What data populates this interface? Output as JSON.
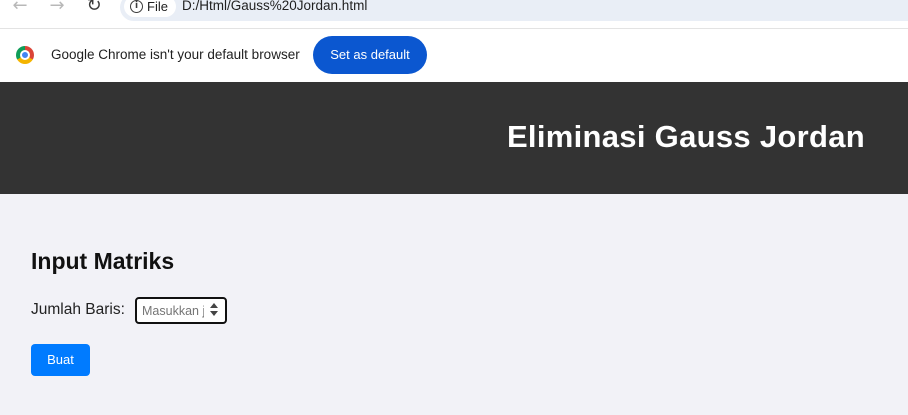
{
  "browser": {
    "site_chip_label": "File",
    "url": "D:/Html/Gauss%20Jordan.html",
    "infobar_message": "Google Chrome isn't your default browser",
    "infobar_button": "Set as default"
  },
  "header": {
    "title": "Eliminasi Gauss Jordan"
  },
  "form": {
    "section_title": "Input Matriks",
    "rows_label": "Jumlah Baris:",
    "rows_placeholder": "Masukkan jumlah baris",
    "submit_label": "Buat"
  },
  "colors": {
    "header_bg": "#333333",
    "content_bg": "#f2f2f7",
    "primary_button": "#007bff",
    "chrome_button": "#0b57d0"
  },
  "icons": [
    "back-arrow-icon",
    "forward-arrow-icon",
    "reload-icon",
    "info-icon",
    "chrome-logo-icon",
    "spinner-icon"
  ]
}
